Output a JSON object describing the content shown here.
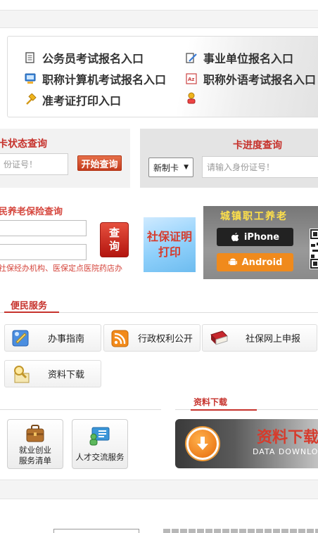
{
  "entry_links": [
    {
      "label": "公务员考试报名入口",
      "icon": "document-icon"
    },
    {
      "label": "事业单位报名入口",
      "icon": "pencil-form-icon"
    },
    {
      "label": "职称计算机考试报名入口",
      "icon": "computer-icon"
    },
    {
      "label": "职称外语考试报名入口",
      "icon": "language-icon"
    },
    {
      "label": "准考证打印入口",
      "icon": "hammer-icon"
    },
    {
      "label": "",
      "icon": "person-icon"
    }
  ],
  "card_status": {
    "title": "卡状态查询",
    "input_placeholder": "份证号！",
    "button_label": "开始查询"
  },
  "card_progress": {
    "title": "卡进度查询",
    "select_value": "新制卡",
    "input_placeholder": "请输入身份证号！"
  },
  "pension_query": {
    "title": "民养老保险查询",
    "note": "社保经办机构、医保定点医院药店办",
    "button_lines": [
      "查",
      "询"
    ]
  },
  "print_banner": {
    "lines": [
      "社保证明",
      "打印"
    ]
  },
  "app_banner": {
    "title": "城镇职工养老",
    "ios_label": "iPhone",
    "android_label": "Android"
  },
  "services": {
    "section_title": "便民服务",
    "tiles": [
      {
        "label": "办事指南",
        "icon": "guide-icon"
      },
      {
        "label": "行政权利公开",
        "icon": "rss-icon"
      },
      {
        "label": "社保网上申报",
        "icon": "book-icon"
      },
      {
        "label": "资料下载",
        "icon": "magnifier-icon"
      }
    ]
  },
  "downloads": {
    "section_title": "资料下载",
    "banner_text": "资料下载",
    "banner_en": "DATA DOWNLO"
  },
  "biz_buttons": [
    {
      "lines": [
        "就业创业",
        "服务清单"
      ],
      "icon": "briefcase-icon"
    },
    {
      "lines": [
        "人才交流服务"
      ],
      "icon": "people-board-icon"
    }
  ]
}
